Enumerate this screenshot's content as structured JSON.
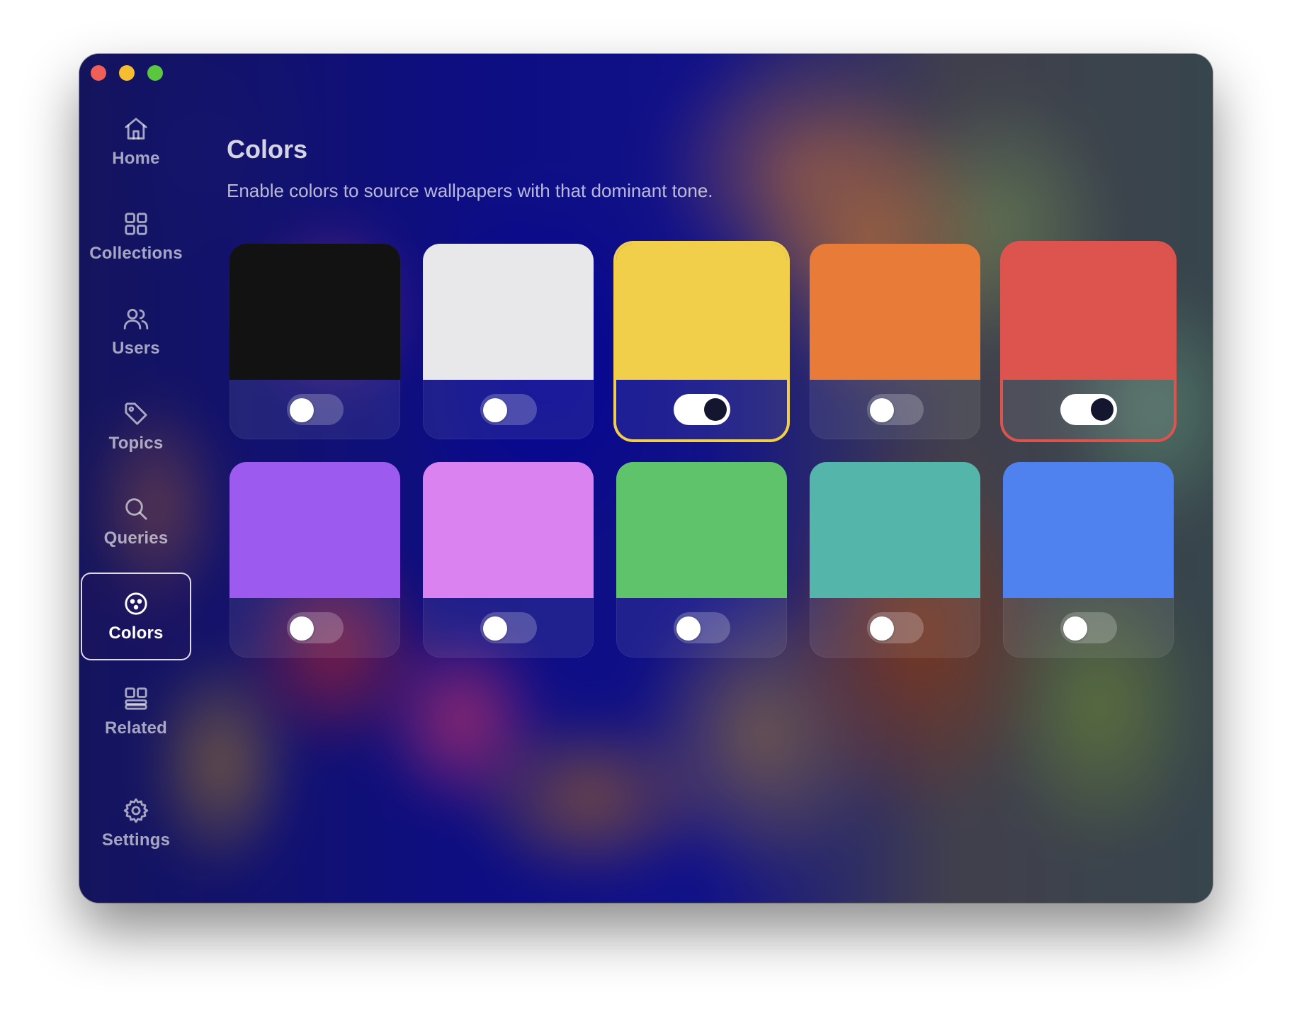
{
  "window": {
    "controls": [
      "close",
      "minimize",
      "zoom"
    ]
  },
  "sidebar": {
    "items": [
      {
        "label": "Home",
        "icon": "home-icon",
        "active": false
      },
      {
        "label": "Collections",
        "icon": "grid-icon",
        "active": false
      },
      {
        "label": "Users",
        "icon": "users-icon",
        "active": false
      },
      {
        "label": "Topics",
        "icon": "tag-icon",
        "active": false
      },
      {
        "label": "Queries",
        "icon": "search-icon",
        "active": false
      },
      {
        "label": "Colors",
        "icon": "palette-icon",
        "active": true
      },
      {
        "label": "Related",
        "icon": "layout-icon",
        "active": false
      },
      {
        "label": "Settings",
        "icon": "gear-icon",
        "active": false
      }
    ]
  },
  "main": {
    "title": "Colors",
    "subtitle": "Enable colors to source wallpapers with that dominant tone.",
    "colors": [
      {
        "id": "black",
        "swatch": "#121212",
        "enabled": false
      },
      {
        "id": "white",
        "swatch": "#e8e8ea",
        "enabled": false
      },
      {
        "id": "yellow",
        "swatch": "#f2cf4a",
        "enabled": true,
        "ring": "#f2cf4a"
      },
      {
        "id": "orange",
        "swatch": "#e77b37",
        "enabled": false
      },
      {
        "id": "red",
        "swatch": "#dd534e",
        "enabled": true,
        "ring": "#dd534e"
      },
      {
        "id": "purple",
        "swatch": "#9d5aee",
        "enabled": false
      },
      {
        "id": "pink",
        "swatch": "#da83f0",
        "enabled": false
      },
      {
        "id": "green",
        "swatch": "#5ec36a",
        "enabled": false
      },
      {
        "id": "teal",
        "swatch": "#54b6aa",
        "enabled": false
      },
      {
        "id": "blue",
        "swatch": "#4f82ee",
        "enabled": false
      }
    ]
  }
}
